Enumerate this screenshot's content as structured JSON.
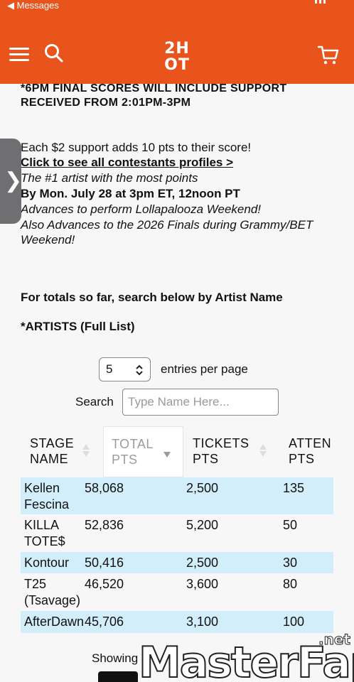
{
  "status": {
    "back_label": "◀ Messages"
  },
  "header": {
    "logo_text": "2H OT",
    "brand_color": "#e8541c"
  },
  "content": {
    "notice_line1": "*6PM FINAL SCORES WILL INCLUDE SUPPORT",
    "notice_line2": "RECEIVED FROM 2:01PM-3PM",
    "support_info": "Each $2 support adds 10 pts to their score!",
    "profiles_link": "Click to see all contestants profiles >",
    "line_italic1": "The #1 artist with the most points",
    "line_bold_date": "By Mon. July 28 at 3pm ET, 12noon PT",
    "line_italic2": "Advances to perform Lollapalooza Weekend!",
    "line_italic3a": "Also Advances to the 2026 Finals during Grammy/BET",
    "line_italic3b": "Weekend!",
    "totals_heading": "For totals so far, search below by Artist Name",
    "artists_heading": "*ARTISTS (Full List)"
  },
  "side_tab": {
    "glyph": "❯"
  },
  "controls": {
    "entries_value": "5",
    "entries_label": "entries per page",
    "search_label": "Search",
    "search_placeholder": "Type Name Here..."
  },
  "table": {
    "headers": [
      {
        "line1": "STAGE",
        "line2": "NAME"
      },
      {
        "line1": "TOTAL",
        "line2": "PTS"
      },
      {
        "line1": "TICKETS",
        "line2": "PTS"
      },
      {
        "line1": "ATTEN",
        "line2": "PTS"
      }
    ],
    "rows": [
      {
        "name1": "Kellen",
        "name2": "Fescina",
        "total": "58,068",
        "tickets": "2,500",
        "atten": "135"
      },
      {
        "name1": "KILLA",
        "name2": "TOTE$",
        "total": "52,836",
        "tickets": "5,200",
        "atten": "50"
      },
      {
        "name1": "Kontour",
        "name2": "",
        "total": "50,416",
        "tickets": "2,500",
        "atten": "30"
      },
      {
        "name1": "T25",
        "name2": "(Tsavage)",
        "total": "46,520",
        "tickets": "3,600",
        "atten": "80"
      },
      {
        "name1": "AfterDawn",
        "name2": "",
        "total": "45,706",
        "tickets": "3,100",
        "atten": "100"
      }
    ]
  },
  "footer": {
    "showing_text": "Showing"
  },
  "watermark": {
    "text": "MasterFap",
    "suffix": ".net"
  }
}
